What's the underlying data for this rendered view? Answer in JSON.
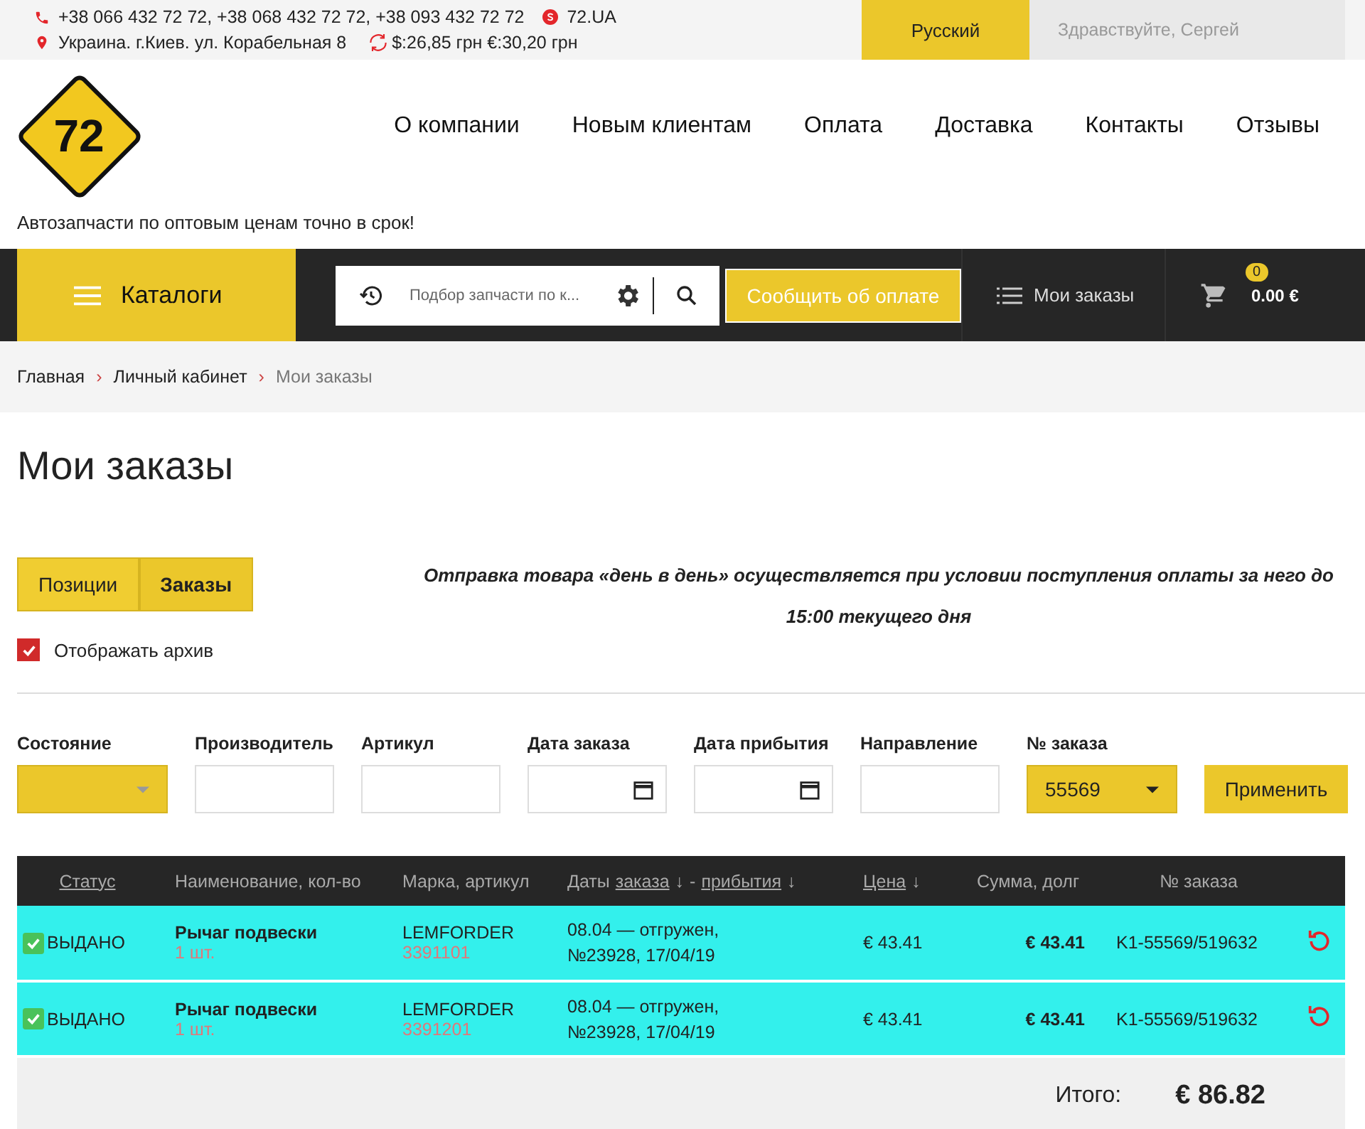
{
  "top_bar": {
    "phones": "+38 066 432 72 72, +38 068 432 72 72, +38 093 432 72 72",
    "skype": "72.UA",
    "address": "Украина. г.Киев. ул. Корабельная 8",
    "rates": "$:26,85 грн €:30,20 грн",
    "language": "Русский",
    "greeting": "Здравствуйте, Сергей"
  },
  "logo": {
    "text": "72"
  },
  "tagline": "Автозапчасти по оптовым ценам точно в срок!",
  "nav": [
    {
      "label": "О компании"
    },
    {
      "label": "Новым клиентам"
    },
    {
      "label": "Оплата"
    },
    {
      "label": "Доставка"
    },
    {
      "label": "Контакты"
    },
    {
      "label": "Отзывы"
    }
  ],
  "toolbar": {
    "catalog_button": "Каталоги",
    "search": {
      "placeholder": "Подбор запчасти по к..."
    },
    "report_button": "Сообщить об оплате",
    "orders_link": "Мои заказы",
    "cart": {
      "count": "0",
      "total": "0.00 €"
    }
  },
  "breadcrumb": [
    {
      "label": "Главная",
      "current": false
    },
    {
      "separator": "›",
      "label": "Личный кабинет",
      "current": false
    },
    {
      "separator": "›",
      "label": "Мои заказы",
      "current": true
    }
  ],
  "page_title": "Мои заказы",
  "tabs": [
    {
      "label": "Позиции",
      "selected": false
    },
    {
      "label": "Заказы",
      "selected": true
    }
  ],
  "notice": "Отправка товара «день в день» осуществляется при условии поступления оплаты за него до 15:00 текущего дня",
  "archive": {
    "label": "Отображать архив",
    "checked": true
  },
  "filters": [
    {
      "label": "Состояние",
      "kind": "select"
    },
    {
      "label": "Производитель",
      "kind": "text"
    },
    {
      "label": "Артикул",
      "kind": "text"
    },
    {
      "label": "Дата заказа",
      "kind": "date"
    },
    {
      "label": "Дата прибытия",
      "kind": "date"
    },
    {
      "label": "Направление",
      "kind": "text"
    },
    {
      "label": "№ заказа",
      "kind": "select",
      "value": "55569"
    }
  ],
  "apply_button": "Применить",
  "table": {
    "columns": [
      {
        "parts": [
          {
            "text": "Статус",
            "link": true
          }
        ]
      },
      {
        "parts": [
          {
            "text": "Наименование, кол-во",
            "link": false
          }
        ]
      },
      {
        "parts": [
          {
            "text": "Марка, артикул",
            "link": false
          }
        ]
      },
      {
        "parts": [
          {
            "text": "Даты",
            "link": false
          },
          {
            "text": "заказа",
            "link": true
          },
          {
            "text": "↓",
            "link": false
          },
          {
            "text": "-",
            "link": false
          },
          {
            "text": "прибытия",
            "link": true
          },
          {
            "text": "↓",
            "link": false
          }
        ]
      },
      {
        "parts": [
          {
            "text": "Цена",
            "link": true
          },
          {
            "text": "↓",
            "link": false
          }
        ]
      },
      {
        "parts": [
          {
            "text": "Сумма, долг",
            "link": false
          }
        ]
      },
      {
        "parts": [
          {
            "text": "№ заказа",
            "link": false
          }
        ]
      }
    ],
    "rows": [
      {
        "status": "ВЫДАНО",
        "checked": true,
        "name": "Рычаг подвески",
        "qty": "1 шт.",
        "brand": "LEMFORDER",
        "article": "3391101",
        "dates": "08.04 — отгружен, №23928, 17/04/19",
        "price": "€ 43.41",
        "sum": "€ 43.41",
        "order_no": "K1-55569/519632"
      },
      {
        "status": "ВЫДАНО",
        "checked": true,
        "name": "Рычаг подвески",
        "qty": "1 шт.",
        "brand": "LEMFORDER",
        "article": "3391201",
        "dates": "08.04 — отгружен, №23928, 17/04/19",
        "price": "€ 43.41",
        "sum": "€ 43.41",
        "order_no": "K1-55569/519632"
      }
    ],
    "total_label": "Итого:",
    "total_value": "€ 86.82"
  }
}
